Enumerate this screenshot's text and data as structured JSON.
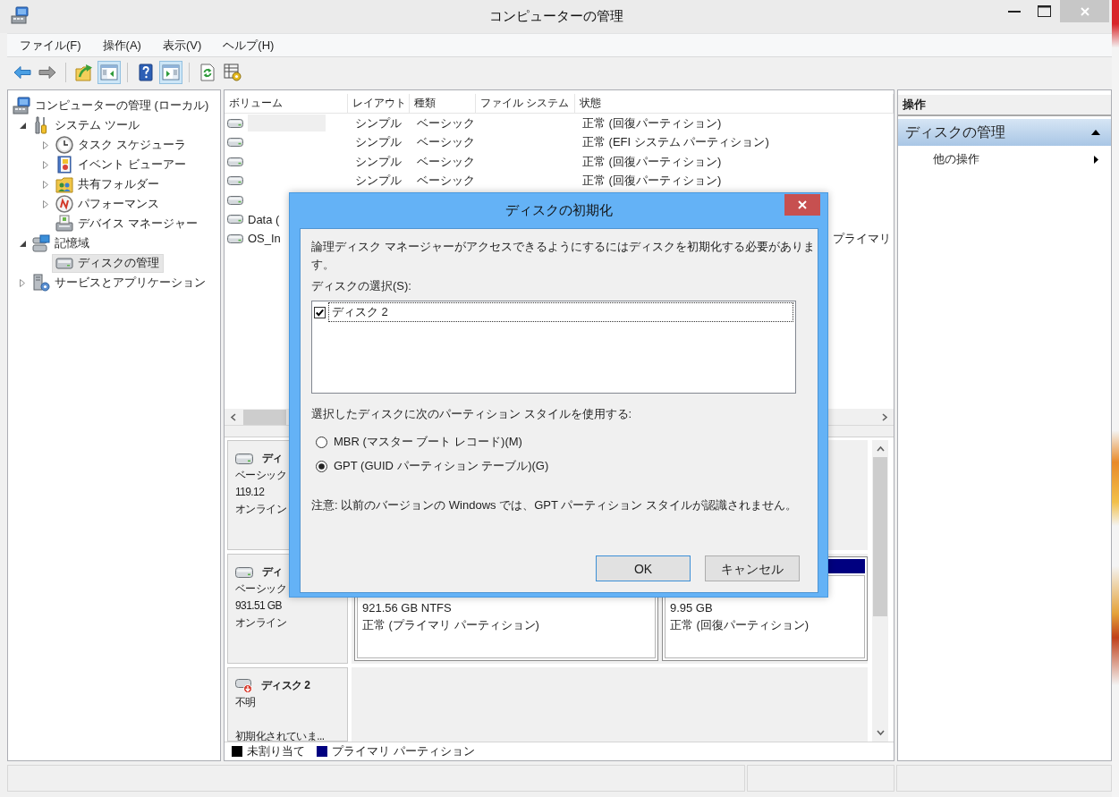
{
  "window": {
    "title": "コンピューターの管理"
  },
  "menu": [
    {
      "label": "ファイル(F)"
    },
    {
      "label": "操作(A)"
    },
    {
      "label": "表示(V)"
    },
    {
      "label": "ヘルプ(H)"
    }
  ],
  "toolbar": [
    {
      "pressed": false
    },
    {
      "pressed": false
    },
    {
      "pressed": false
    },
    {
      "pressed": true
    },
    {
      "pressed": false
    },
    {
      "pressed": true
    },
    {
      "pressed": false
    },
    {
      "pressed": false
    }
  ],
  "tree": [
    {
      "label": "コンピューターの管理 (ローカル)",
      "kind": "computer",
      "selected": false,
      "children": [
        {
          "label": "システム ツール",
          "kind": "tools",
          "expanded": true,
          "selected": false,
          "children": [
            {
              "label": "タスク スケジューラ",
              "kind": "clock",
              "expanded": false,
              "selected": false
            },
            {
              "label": "イベント ビューアー",
              "kind": "log",
              "expanded": false,
              "selected": false
            },
            {
              "label": "共有フォルダー",
              "kind": "share",
              "expanded": false,
              "selected": false
            },
            {
              "label": "パフォーマンス",
              "kind": "gauge",
              "expanded": false,
              "selected": false
            },
            {
              "label": "デバイス マネージャー",
              "kind": "device",
              "selected": false
            }
          ]
        },
        {
          "label": "記憶域",
          "kind": "storage",
          "expanded": true,
          "selected": false,
          "children": [
            {
              "label": "ディスクの管理",
              "kind": "disk",
              "selected": true
            }
          ]
        },
        {
          "label": "サービスとアプリケーション",
          "kind": "services",
          "expanded": false,
          "selected": false
        }
      ]
    }
  ],
  "volumes": {
    "columns": [
      "ボリューム",
      "レイアウト",
      "種類",
      "ファイル システム",
      "状態"
    ],
    "rows": [
      {
        "selected": true,
        "layout": "シンプル",
        "type": "ベーシック",
        "status": "正常 (回復パーティション)"
      },
      {
        "selected": false,
        "layout": "シンプル",
        "type": "ベーシック",
        "status": "正常 (EFI システム パーティション)"
      },
      {
        "selected": false,
        "layout": "シンプル",
        "type": "ベーシック",
        "status": "正常 (回復パーティション)"
      },
      {
        "selected": false,
        "layout": "シンプル",
        "type": "ベーシック",
        "status": "正常 (回復パーティション)"
      },
      {
        "selected": false
      },
      {
        "selected": false,
        "volume": "Data ("
      },
      {
        "selected": false,
        "volume": "OS_In",
        "status_end": "プライマリ"
      }
    ]
  },
  "disks": [
    {
      "name": "ディ",
      "initialized": true,
      "type": "ベーシック",
      "size": "119.12",
      "state": "オンライン"
    },
    {
      "name": "ディ",
      "initialized": true,
      "type": "ベーシック",
      "size": "931.51 GB",
      "state": "オンライン",
      "partitions": [
        {
          "size": "921.56 GB NTFS",
          "status": "正常 (プライマリ パーティション)"
        },
        {
          "size": "9.95 GB",
          "status": "正常 (回復パーティション)"
        }
      ]
    },
    {
      "name": "ディスク 2",
      "initialized": false,
      "type": "不明",
      "state": "初期化されていま..."
    }
  ],
  "legend": [
    {
      "label": "未割り当て",
      "color": "#000000"
    },
    {
      "label": "プライマリ パーティション",
      "color": "#000080"
    }
  ],
  "actions": {
    "title": "操作",
    "sections": [
      {
        "label": "ディスクの管理",
        "expanded": true,
        "items": [
          {
            "label": "他の操作"
          }
        ]
      }
    ]
  },
  "dialog": {
    "title": "ディスクの初期化",
    "message": "論理ディスク マネージャーがアクセスできるようにするにはディスクを初期化する必要があります。",
    "disk_list_label": "ディスクの選択(S):",
    "disks": [
      {
        "label": "ディスク 2",
        "checked": true,
        "selected": true
      }
    ],
    "style_label": "選択したディスクに次のパーティション スタイルを使用する:",
    "styles": [
      {
        "label": "MBR (マスター ブート レコード)(M)",
        "selected": false
      },
      {
        "label": "GPT (GUID パーティション テーブル)(G)",
        "selected": true
      }
    ],
    "note": "注意: 以前のバージョンの Windows では、GPT パーティション スタイルが認識されません。",
    "buttons": [
      {
        "label": "OK",
        "default": true
      },
      {
        "label": "キャンセル",
        "default": false
      }
    ]
  }
}
